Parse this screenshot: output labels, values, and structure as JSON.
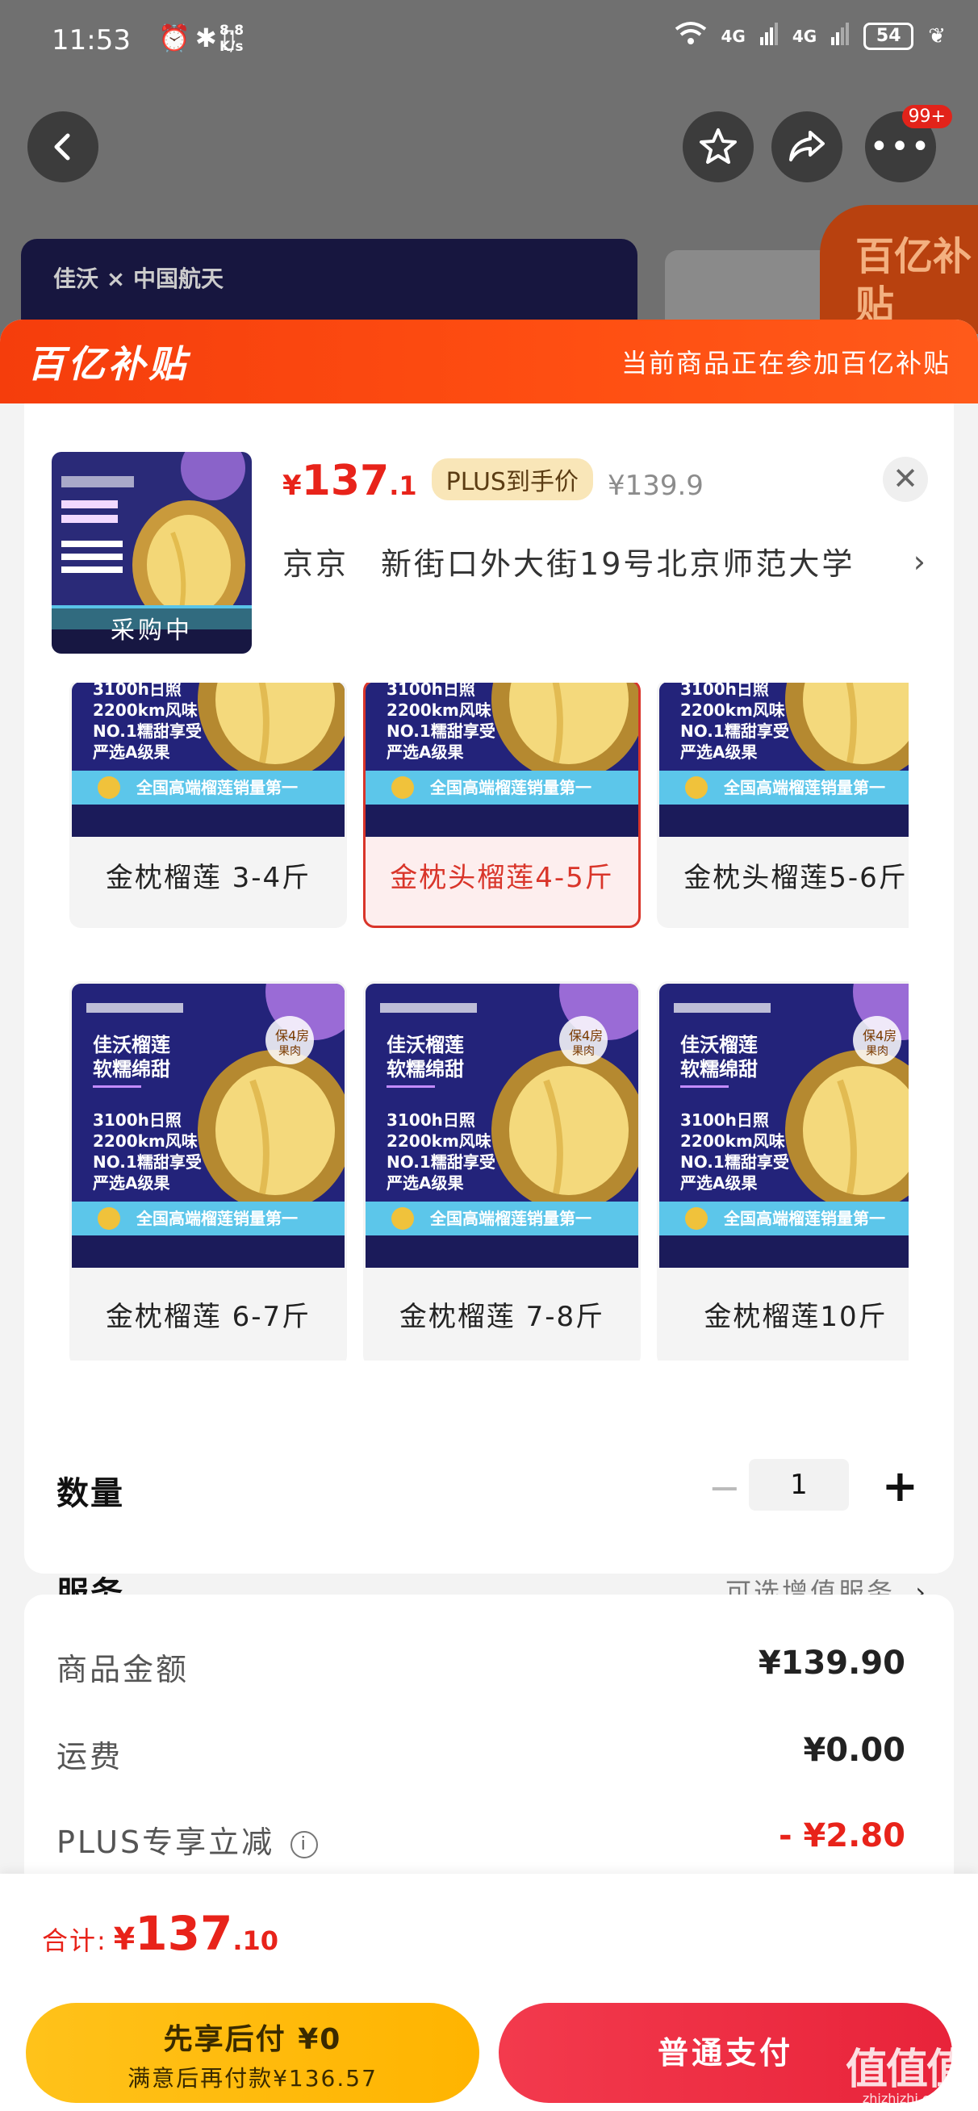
{
  "status_bar": {
    "time": "11:53",
    "network_speed": "8.8 K/s",
    "signal1": "4G",
    "signal2": "4G",
    "battery": "54"
  },
  "nav": {
    "badge": "99+"
  },
  "background": {
    "banner_brand": "佳沃 × 中国航天",
    "subsidy_badge": "百亿补贴"
  },
  "sheet": {
    "subsidy_logo": "百亿补贴",
    "subsidy_tip": "当前商品正在参加百亿补贴",
    "product": {
      "thumb_status": "采购中",
      "price_symbol": "¥",
      "price_int": "137",
      "price_dec": ".1",
      "plus_tag": "PLUS到手价",
      "original_price": "¥139.9"
    },
    "address": {
      "city": "京京",
      "detail": "新街口外大街19号北京师范大学"
    },
    "sku_options": [
      {
        "label": "金枕榴莲 3-4斤",
        "selected": false
      },
      {
        "label": "金枕头榴莲4-5斤",
        "selected": true
      },
      {
        "label": "金枕头榴莲5-6斤",
        "selected": false
      },
      {
        "label": "金枕榴莲 6-7斤",
        "selected": false
      },
      {
        "label": "金枕榴莲 7-8斤",
        "selected": false
      },
      {
        "label": "金枕榴莲10斤",
        "selected": false
      }
    ],
    "sku_image": {
      "brand": "佳沃榴莲",
      "slogan1": "软糯绵甜",
      "facts": [
        "3100h日照",
        "2200km风味",
        "NO.1糯甜享受",
        "严选A级果"
      ],
      "footer": "全国高端榴莲销量第一",
      "badge": "保4房果肉"
    },
    "quantity": {
      "label": "数量",
      "minus": "−",
      "value": "1",
      "plus": "+"
    },
    "service": {
      "label": "服务",
      "hint": "可选增值服务"
    },
    "summary": {
      "goods_label": "商品金额",
      "goods_value": "¥139.90",
      "shipping_label": "运费",
      "shipping_value": "¥0.00",
      "plus_label": "PLUS专享立减",
      "plus_value": "- ¥2.80"
    }
  },
  "bottom": {
    "total_label": "合计:",
    "total_symbol": "¥",
    "total_int": "137",
    "total_dec": ".10",
    "pay_later_main": "先享后付 ¥0",
    "pay_later_sub": "满意后再付款¥136.57",
    "pay_normal": "普通支付",
    "watermark_main": "值值值",
    "watermark_sub": "zhizhizhi.com"
  },
  "colors": {
    "accent_red": "#e8231a",
    "subsidy_orange": "#ff4f12",
    "plus_gold": "#f9e6b8",
    "pay_later_yellow": "#ffc21a"
  }
}
